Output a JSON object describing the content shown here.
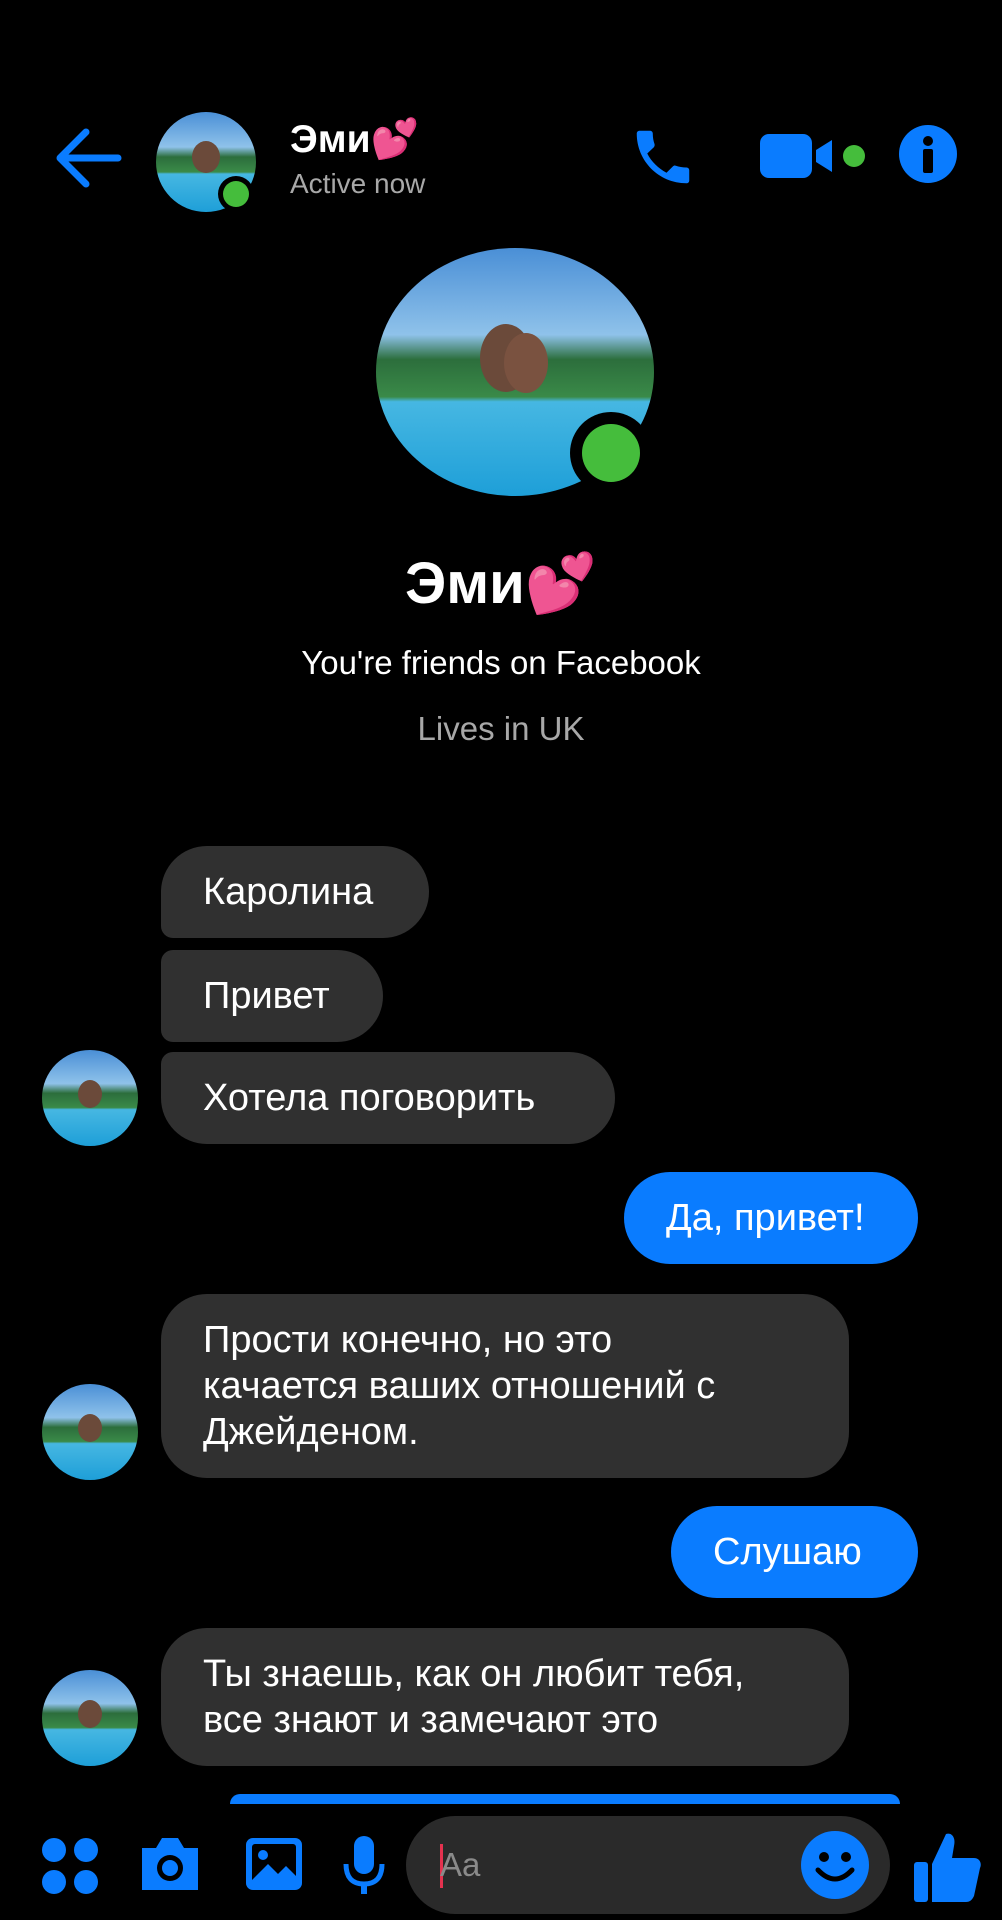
{
  "header": {
    "name": "Эми💕",
    "status": "Active now"
  },
  "profile": {
    "name": "Эми💕",
    "friends_text": "You're friends on Facebook",
    "lives_text": "Lives in UK"
  },
  "messages": [
    {
      "sender": "them",
      "text": "Каролина"
    },
    {
      "sender": "them",
      "text": "Привет"
    },
    {
      "sender": "them",
      "text": "Хотела поговорить"
    },
    {
      "sender": "me",
      "text": "Да, привет!"
    },
    {
      "sender": "them",
      "text": "Прости конечно, но это\nкачается ваших отношений с\nДжейденом."
    },
    {
      "sender": "me",
      "text": "Слушаю"
    },
    {
      "sender": "them",
      "text": "Ты знаешь, как он любит тебя,\nвсе знают и замечают это"
    }
  ],
  "composer": {
    "placeholder": "Aa"
  },
  "colors": {
    "accent": "#0a7cff",
    "online": "#45bd3c",
    "bubble_other": "#303030"
  },
  "icons": [
    "back-arrow-icon",
    "phone-icon",
    "video-icon",
    "info-icon",
    "apps-grid-icon",
    "camera-icon",
    "gallery-icon",
    "microphone-icon",
    "emoji-icon",
    "thumbs-up-icon"
  ]
}
